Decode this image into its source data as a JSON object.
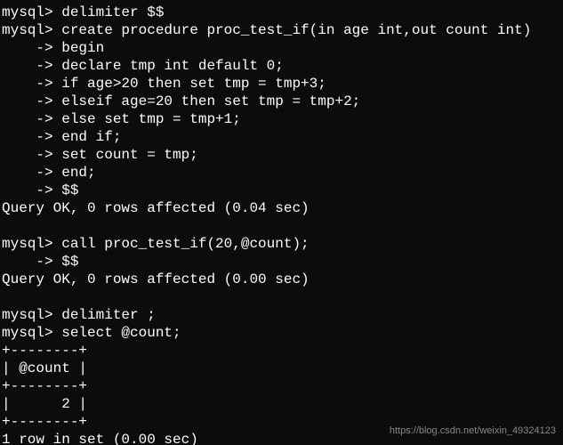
{
  "lines": [
    "mysql> delimiter $$",
    "mysql> create procedure proc_test_if(in age int,out count int)",
    "    -> begin",
    "    -> declare tmp int default 0;",
    "    -> if age>20 then set tmp = tmp+3;",
    "    -> elseif age=20 then set tmp = tmp+2;",
    "    -> else set tmp = tmp+1;",
    "    -> end if;",
    "    -> set count = tmp;",
    "    -> end;",
    "    -> $$",
    "Query OK, 0 rows affected (0.04 sec)",
    "",
    "mysql> call proc_test_if(20,@count);",
    "    -> $$",
    "Query OK, 0 rows affected (0.00 sec)",
    "",
    "mysql> delimiter ;",
    "mysql> select @count;",
    "+--------+",
    "| @count |",
    "+--------+",
    "|      2 |",
    "+--------+",
    "1 row in set (0.00 sec)"
  ],
  "watermark": "https://blog.csdn.net/weixin_49324123"
}
